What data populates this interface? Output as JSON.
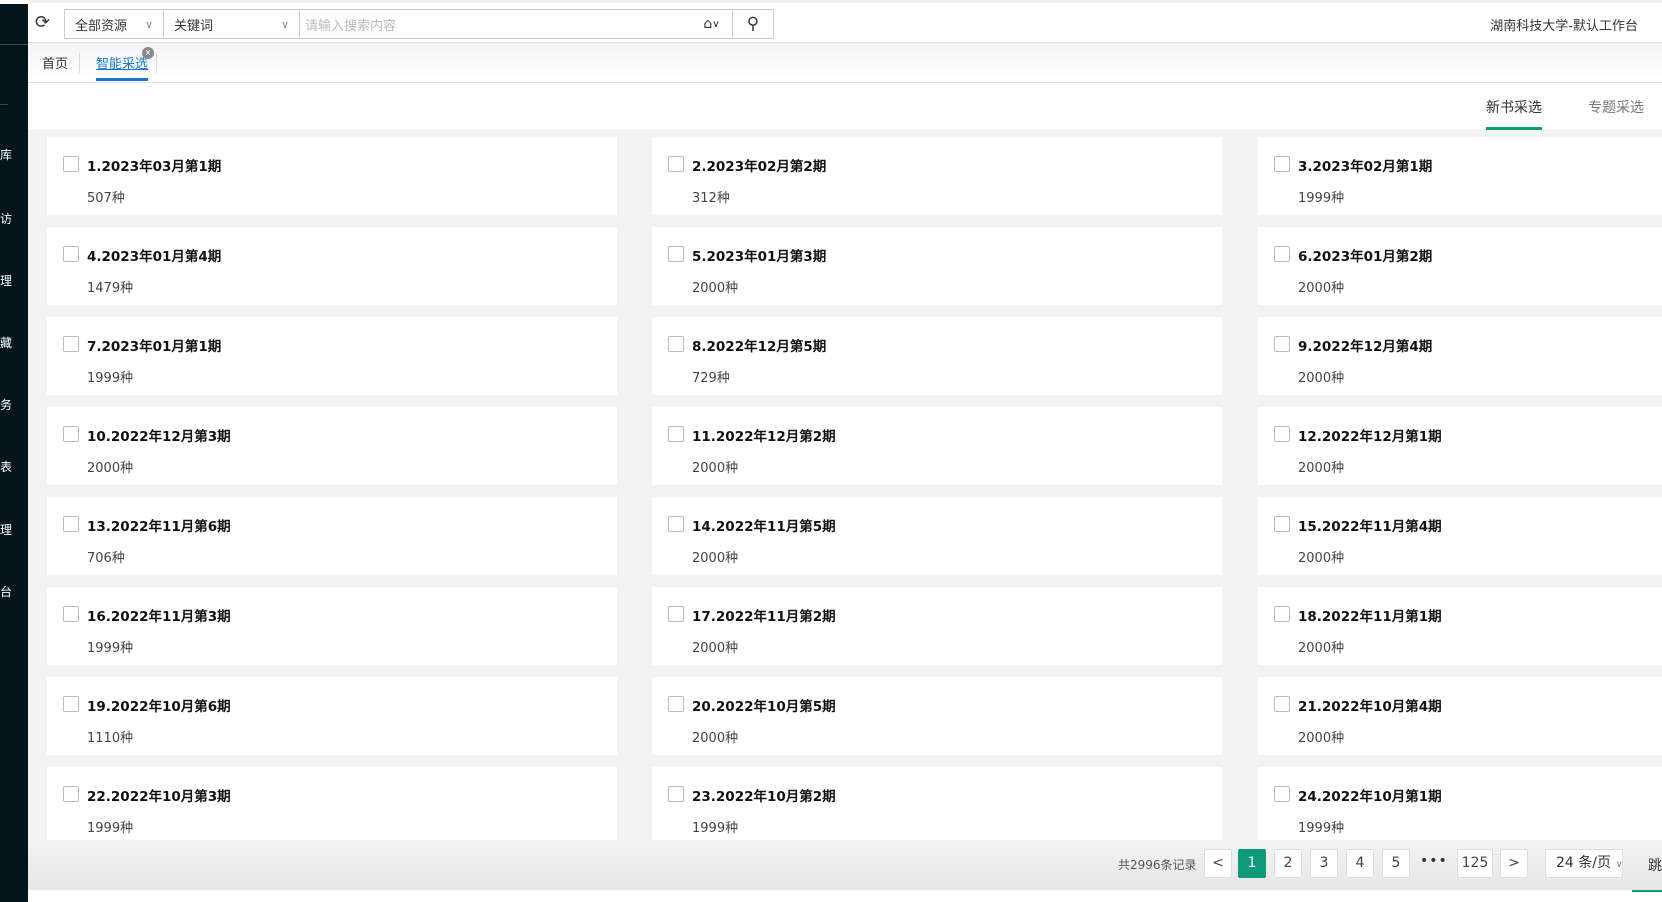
{
  "sidebar": {
    "items": [
      "库",
      "访",
      "理",
      "藏",
      "务",
      "表",
      "理",
      "台"
    ]
  },
  "topbar": {
    "resource_select": "全部资源",
    "field_select": "关键词",
    "search_placeholder": "请输入搜索内容",
    "org": "湖南科技大学-默认工作台"
  },
  "tabs": {
    "home": "首页",
    "active": "智能采选",
    "close": "x"
  },
  "subtabs": [
    "新书采选",
    "专题采选"
  ],
  "cards": [
    {
      "title": "1.2023年03月第1期",
      "count": "507种"
    },
    {
      "title": "2.2023年02月第2期",
      "count": "312种"
    },
    {
      "title": "3.2023年02月第1期",
      "count": "1999种"
    },
    {
      "title": "4.2023年01月第4期",
      "count": "1479种"
    },
    {
      "title": "5.2023年01月第3期",
      "count": "2000种"
    },
    {
      "title": "6.2023年01月第2期",
      "count": "2000种"
    },
    {
      "title": "7.2023年01月第1期",
      "count": "1999种"
    },
    {
      "title": "8.2022年12月第5期",
      "count": "729种"
    },
    {
      "title": "9.2022年12月第4期",
      "count": "2000种"
    },
    {
      "title": "10.2022年12月第3期",
      "count": "2000种"
    },
    {
      "title": "11.2022年12月第2期",
      "count": "2000种"
    },
    {
      "title": "12.2022年12月第1期",
      "count": "2000种"
    },
    {
      "title": "13.2022年11月第6期",
      "count": "706种"
    },
    {
      "title": "14.2022年11月第5期",
      "count": "2000种"
    },
    {
      "title": "15.2022年11月第4期",
      "count": "2000种"
    },
    {
      "title": "16.2022年11月第3期",
      "count": "1999种"
    },
    {
      "title": "17.2022年11月第2期",
      "count": "2000种"
    },
    {
      "title": "18.2022年11月第1期",
      "count": "2000种"
    },
    {
      "title": "19.2022年10月第6期",
      "count": "1110种"
    },
    {
      "title": "20.2022年10月第5期",
      "count": "2000种"
    },
    {
      "title": "21.2022年10月第4期",
      "count": "2000种"
    },
    {
      "title": "22.2022年10月第3期",
      "count": "1999种"
    },
    {
      "title": "23.2022年10月第2期",
      "count": "1999种"
    },
    {
      "title": "24.2022年10月第1期",
      "count": "1999种"
    }
  ],
  "pagination": {
    "total": "共2996条记录",
    "prev": "<",
    "pages": [
      "1",
      "2",
      "3",
      "4",
      "5"
    ],
    "ellipsis": "•••",
    "last": "125",
    "next": ">",
    "page_size": "24 条/页",
    "jump": "跳"
  }
}
